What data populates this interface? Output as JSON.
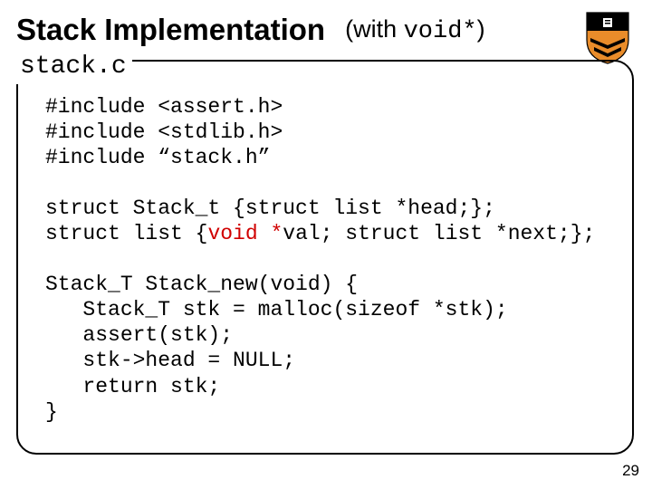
{
  "title": {
    "main": "Stack Implementation",
    "paren_open": "(with ",
    "paren_mono": "void*",
    "paren_close": ")"
  },
  "filename": "stack.c",
  "code": {
    "l1": "#include <assert.h>",
    "l2": "#include <stdlib.h>",
    "l3": "#include “stack.h”",
    "blank1": "",
    "l4a": "struct Stack_t {struct list *head;};",
    "l5a": "struct list {",
    "l5red": "void *",
    "l5b": "val; struct list *next;};",
    "blank2": "",
    "l6": "Stack_T Stack_new(void) {",
    "l7": "   Stack_T stk = malloc(sizeof *stk);",
    "l8": "   assert(stk);",
    "l9": "   stk->head = NULL;",
    "l10": "   return stk;",
    "l11": "}"
  },
  "page_number": "29",
  "shield_colors": {
    "top": "#000000",
    "bottom": "#e98c2a",
    "chevrons": "#000000"
  }
}
